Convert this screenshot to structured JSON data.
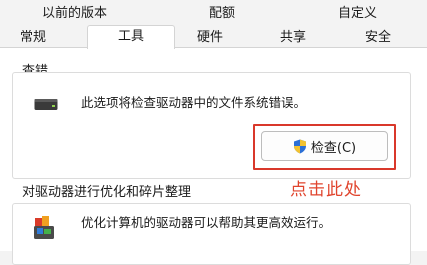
{
  "tabs_row1": [
    {
      "label": "以前的版本"
    },
    {
      "label": "配额"
    },
    {
      "label": "自定义"
    }
  ],
  "tabs_row2": [
    {
      "label": "常规"
    },
    {
      "label": "工具"
    },
    {
      "label": "硬件"
    },
    {
      "label": "共享"
    },
    {
      "label": "安全"
    }
  ],
  "error_check": {
    "title": "查错",
    "description": "此选项将检查驱动器中的文件系统错误。",
    "button_label": "检查(C)"
  },
  "annotation": "点击此处",
  "optimize": {
    "title": "对驱动器进行优化和碎片整理",
    "description": "优化计算机的驱动器可以帮助其更高效运行。"
  },
  "colors": {
    "highlight": "#d9382b",
    "annotation": "#e0442d",
    "shield_blue": "#2b6fd6",
    "shield_yellow": "#f2c230"
  }
}
